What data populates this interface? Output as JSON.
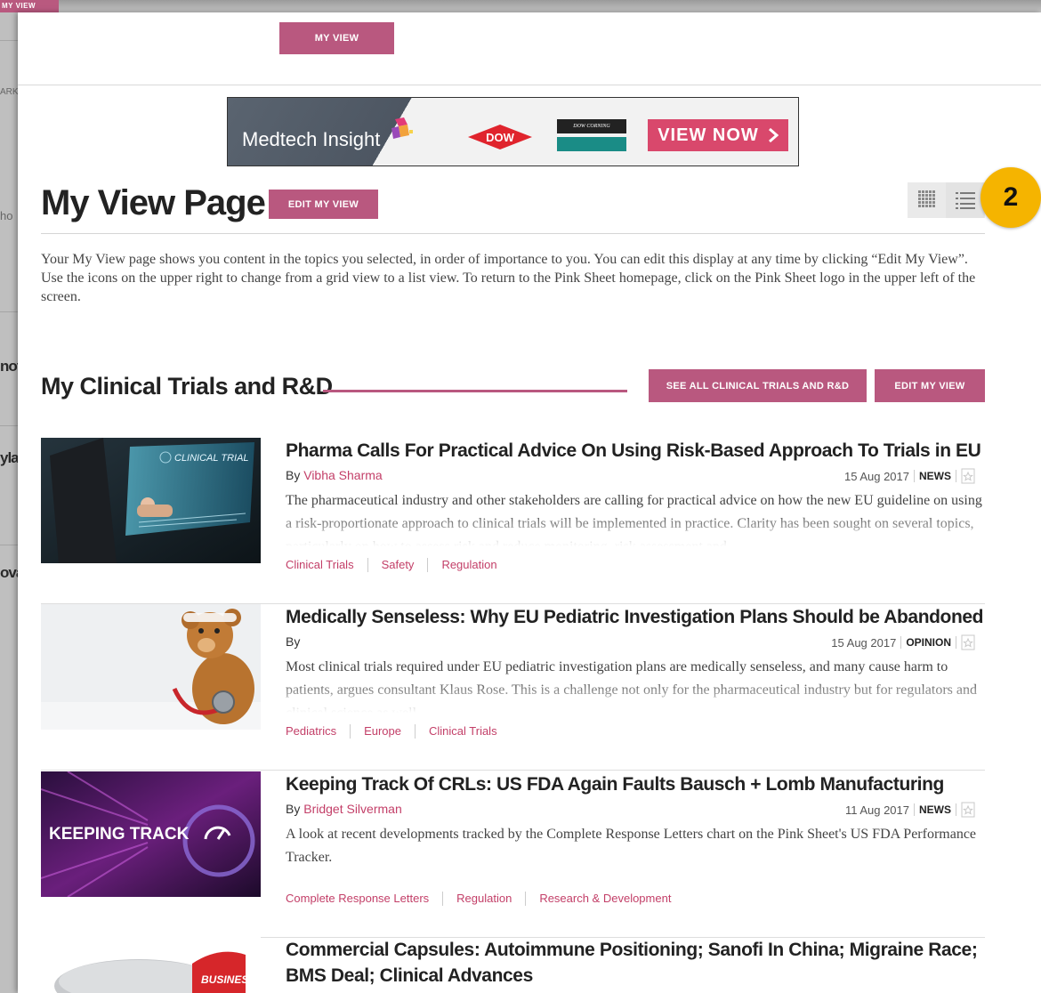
{
  "background": {
    "tab_label": "MY VIEW",
    "fragments": [
      "ARK",
      "ho",
      "nof",
      "yla",
      "ova"
    ]
  },
  "top": {
    "my_view_label": "MY VIEW"
  },
  "ad": {
    "brand": "Medtech Insight",
    "partner1": "DOW",
    "partner2": "DOW CORNING",
    "cta": "VIEW NOW"
  },
  "header": {
    "title": "My View Page",
    "edit_label": "EDIT MY VIEW",
    "intro": "Your My View page shows you content in the topics you selected, in order of importance to you. You can edit this display at any time by clicking “Edit My View”. Use the icons on the upper right to change from a grid view to a list view. To return to the Pink Sheet homepage, click on the Pink Sheet logo in the upper left of the screen."
  },
  "badge": "2",
  "section": {
    "title": "My Clinical Trials and R&D",
    "see_all_label": "SEE ALL CLINICAL TRIALS AND R&D",
    "edit_label": "EDIT MY VIEW"
  },
  "articles": [
    {
      "title": "Pharma Calls For Practical Advice On Using Risk-Based Approach To Trials in EU",
      "by": "By",
      "author": "Vibha Sharma",
      "date": "15 Aug 2017",
      "type": "NEWS",
      "summary": "The pharmaceutical industry and other stakeholders are calling for practical advice on how the new EU guideline on using a risk-proportionate approach to clinical trials will be implemented in practice. Clarity has been sought on several topics, particularly on how to assess risk and reduce monitoring, risk assessment and",
      "thumb_text": "CLINICAL TRIAL",
      "tags": [
        "Clinical Trials",
        "Safety",
        "Regulation"
      ]
    },
    {
      "title": "Medically Senseless: Why EU Pediatric Investigation Plans Should be Abandoned",
      "by": "By",
      "author": "",
      "date": "15 Aug 2017",
      "type": "OPINION",
      "summary": "Most clinical trials required under EU pediatric investigation plans are medically senseless, and many cause harm to patients, argues consultant Klaus Rose. This is a challenge not only for the pharmaceutical industry but for regulators and clinical science as well.",
      "thumb_text": "",
      "tags": [
        "Pediatrics",
        "Europe",
        "Clinical Trials"
      ]
    },
    {
      "title": "Keeping Track Of CRLs: US FDA Again Faults Bausch + Lomb Manufacturing",
      "by": "By",
      "author": "Bridget Silverman",
      "date": "11 Aug 2017",
      "type": "NEWS",
      "summary": "A look at recent developments tracked by the Complete Response Letters chart on the Pink Sheet's US FDA Performance Tracker.",
      "thumb_text": "KEEPING TRACK",
      "tags": [
        "Complete Response Letters",
        "Regulation",
        "Research & Development"
      ]
    },
    {
      "title": "Commercial Capsules: Autoimmune Positioning; Sanofi In China; Migraine Race; BMS Deal; Clinical Advances",
      "by": "",
      "author": "",
      "date": "",
      "type": "",
      "summary": "",
      "thumb_text": "BUSINESS",
      "tags": []
    }
  ]
}
